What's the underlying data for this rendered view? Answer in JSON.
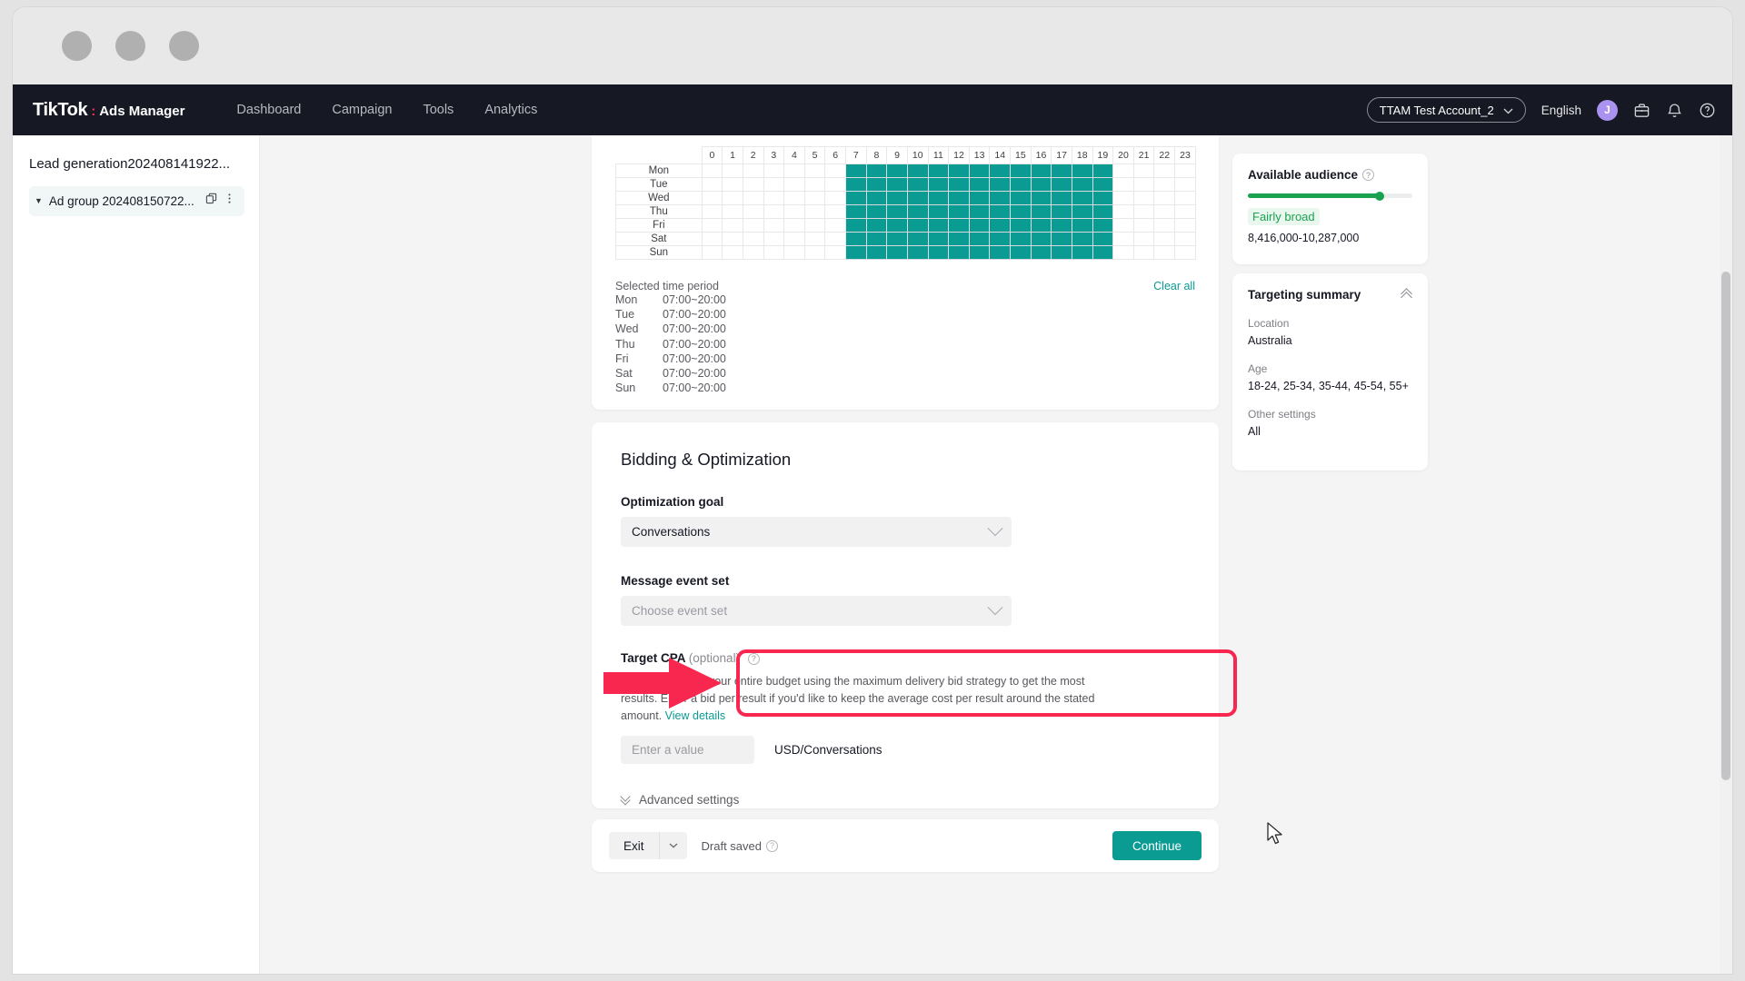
{
  "window": {
    "traffic_lights": [
      "close",
      "minimize",
      "maximize"
    ]
  },
  "topnav": {
    "brand_name": "TikTok",
    "brand_dots": ":",
    "brand_suffix": "Ads Manager",
    "links": [
      {
        "label": "Dashboard"
      },
      {
        "label": "Campaign"
      },
      {
        "label": "Tools"
      },
      {
        "label": "Analytics"
      }
    ],
    "account_selector": "TTAM Test Account_2",
    "language": "English",
    "avatar_initial": "J",
    "icons": [
      "briefcase-icon",
      "bell-icon",
      "question-circle-icon"
    ]
  },
  "sidebar": {
    "campaign_title": "Lead generation202408141922...",
    "adgroup": {
      "label": "Ad group 202408150722...",
      "icons": [
        "copy-icon",
        "more-options-icon"
      ]
    }
  },
  "schedule": {
    "hours": [
      "0",
      "1",
      "2",
      "3",
      "4",
      "5",
      "6",
      "7",
      "8",
      "9",
      "10",
      "11",
      "12",
      "13",
      "14",
      "15",
      "16",
      "17",
      "18",
      "19",
      "20",
      "21",
      "22",
      "23"
    ],
    "days": [
      "Mon",
      "Tue",
      "Wed",
      "Thu",
      "Fri",
      "Sat",
      "Sun"
    ],
    "selected_start_hour": 7,
    "selected_end_hour": 19,
    "selected_label": "Selected time period",
    "clear_all_label": "Clear all",
    "periods": [
      {
        "day": "Mon",
        "range": "07:00~20:00"
      },
      {
        "day": "Tue",
        "range": "07:00~20:00"
      },
      {
        "day": "Wed",
        "range": "07:00~20:00"
      },
      {
        "day": "Thu",
        "range": "07:00~20:00"
      },
      {
        "day": "Fri",
        "range": "07:00~20:00"
      },
      {
        "day": "Sat",
        "range": "07:00~20:00"
      },
      {
        "day": "Sun",
        "range": "07:00~20:00"
      }
    ]
  },
  "bidding": {
    "section_title": "Bidding & Optimization",
    "optimization_goal": {
      "label": "Optimization goal",
      "value": "Conversations"
    },
    "message_event_set": {
      "label": "Message event set",
      "placeholder": "Choose event set",
      "value": ""
    },
    "target_cpa": {
      "label": "Target CPA",
      "optional_tag": "(optional)",
      "description": "We aim to spend your entire budget using the maximum delivery bid strategy to get the most results. Enter a bid per result if you'd like to keep the average cost per result around the stated amount.",
      "view_details_label": "View details",
      "input_placeholder": "Enter a value",
      "input_value": "",
      "unit": "USD/Conversations"
    },
    "advanced_settings_label": "Advanced settings"
  },
  "footer": {
    "exit_label": "Exit",
    "draft_status": "Draft saved",
    "continue_label": "Continue"
  },
  "right_panel": {
    "available_audience": {
      "title": "Available audience",
      "level": "Fairly broad",
      "range": "8,416,000-10,287,000",
      "bar_percent": 80
    },
    "targeting_summary": {
      "title": "Targeting summary",
      "rows": [
        {
          "label": "Location",
          "value": "Australia"
        },
        {
          "label": "Age",
          "value": "18-24, 25-34, 35-44, 45-54, 55+"
        },
        {
          "label": "Other settings",
          "value": "All"
        }
      ]
    }
  },
  "floating": {
    "help_label": "?"
  },
  "annotations": {
    "highlight_color": "#f8274f",
    "arrow_color": "#f8274f",
    "arrow_direction": "right",
    "highlight_target": "message-event-set-field"
  },
  "colors": {
    "teal_accent": "#0a9b93",
    "nav_dark": "#161823",
    "green_audience": "#1aa251",
    "tiktok_pink": "#fe2c55"
  }
}
